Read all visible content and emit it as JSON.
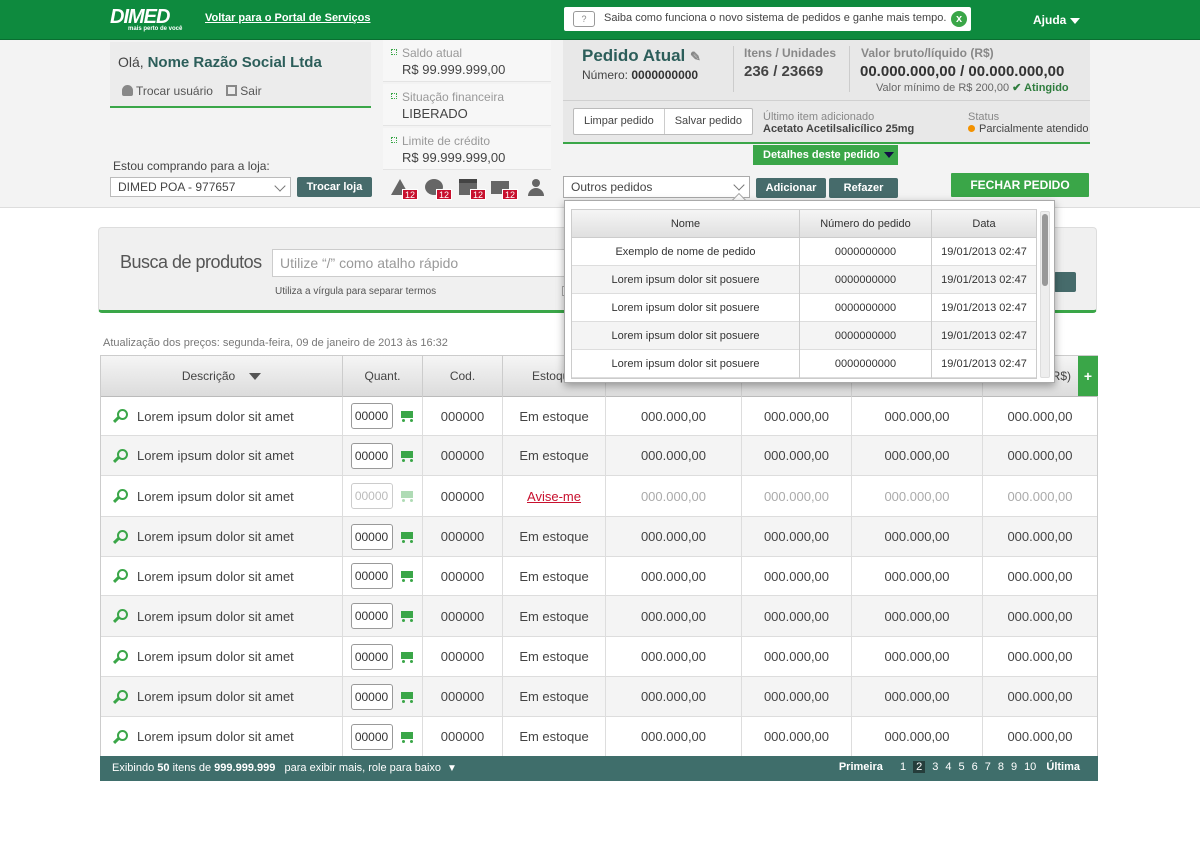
{
  "topbar": {
    "logo": "DIMED",
    "logo_tagline": "mais perto de você",
    "back_link": "Voltar para o Portal de Serviços",
    "notice": "Saiba como funciona o novo sistema de pedidos e ganhe mais tempo.",
    "notice_close": "x",
    "help": "Ajuda"
  },
  "user": {
    "greeting": "Olá,",
    "name": "Nome Razão Social Ltda",
    "switch_user": "Trocar usuário",
    "logout": "Sair"
  },
  "store": {
    "label": "Estou comprando para a loja:",
    "selected": "DIMED POA - 977657",
    "switch_button": "Trocar loja"
  },
  "finance": {
    "balance_label": "Saldo atual",
    "balance_value": "R$ 99.999.999,00",
    "status_label": "Situação financeira",
    "status_value": "LIBERADO",
    "credit_label": "Limite de crédito",
    "credit_value": "R$ 99.999.999,00"
  },
  "alerts": [
    {
      "icon": "warning-icon",
      "count": "12"
    },
    {
      "icon": "money-icon",
      "count": "12"
    },
    {
      "icon": "calendar-icon",
      "count": "12"
    },
    {
      "icon": "mail-icon",
      "count": "12"
    },
    {
      "icon": "user-icon",
      "count": ""
    }
  ],
  "order": {
    "title": "Pedido Atual",
    "number_label": "Número:",
    "number": "0000000000",
    "items_label": "Itens / Unidades",
    "items_value": "236 / 23669",
    "value_label": "Valor bruto/líquido (R$)",
    "value_value": "00.000.000,00 / 00.000.000,00",
    "min_label": "Valor mínimo de R$ 200,00",
    "min_status": "Atingido",
    "clear_button": "Limpar pedido",
    "save_button": "Salvar pedido",
    "last_item_label": "Último item adicionado",
    "last_item_value": "Acetato Acetilsalicílico 25mg",
    "status_label": "Status",
    "status_value": "Parcialmente atendido",
    "details_button": "Detalhes deste pedido",
    "other_orders_select": "Outros pedidos",
    "add_button": "Adicionar",
    "redo_button": "Refazer",
    "close_button": "FECHAR PEDIDO"
  },
  "dropdown": {
    "headers": [
      "Nome",
      "Número do pedido",
      "Data"
    ],
    "rows": [
      [
        "Exemplo de nome de pedido",
        "0000000000",
        "19/01/2013 02:47"
      ],
      [
        "Lorem ipsum dolor sit posuere",
        "0000000000",
        "19/01/2013 02:47"
      ],
      [
        "Lorem ipsum dolor sit posuere",
        "0000000000",
        "19/01/2013 02:47"
      ],
      [
        "Lorem ipsum dolor sit posuere",
        "0000000000",
        "19/01/2013 02:47"
      ],
      [
        "Lorem ipsum dolor sit posuere",
        "0000000000",
        "19/01/2013 02:47"
      ]
    ]
  },
  "search": {
    "title": "Busca de produtos",
    "placeholder": "Utilize “/” como atalho rápido",
    "hint": "Utiliza a vírgula para separar termos"
  },
  "price_update": "Atualização dos preços: segunda-feira, 09 de janeiro de 2013 às 16:32",
  "table": {
    "headers": [
      "Descrição",
      "Quant.",
      "Cod.",
      "Estoque",
      "",
      "",
      "",
      "R$)"
    ],
    "add_column": "+",
    "rows": [
      {
        "desc": "Lorem ipsum dolor sit amet",
        "qty": "00000",
        "code": "000000",
        "stock": "Em estoque",
        "p1": "000.000,00",
        "p2": "000.000,00",
        "p3": "000.000,00",
        "p4": "000.000,00"
      },
      {
        "desc": "Lorem ipsum dolor sit amet",
        "qty": "00000",
        "code": "000000",
        "stock": "Em estoque",
        "p1": "000.000,00",
        "p2": "000.000,00",
        "p3": "000.000,00",
        "p4": "000.000,00"
      },
      {
        "desc": "Lorem ipsum dolor sit amet",
        "qty": "00000",
        "code": "000000",
        "stock": "Avise-me",
        "p1": "000.000,00",
        "p2": "000.000,00",
        "p3": "000.000,00",
        "p4": "000.000,00"
      },
      {
        "desc": "Lorem ipsum dolor sit amet",
        "qty": "00000",
        "code": "000000",
        "stock": "Em estoque",
        "p1": "000.000,00",
        "p2": "000.000,00",
        "p3": "000.000,00",
        "p4": "000.000,00"
      },
      {
        "desc": "Lorem ipsum dolor sit amet",
        "qty": "00000",
        "code": "000000",
        "stock": "Em estoque",
        "p1": "000.000,00",
        "p2": "000.000,00",
        "p3": "000.000,00",
        "p4": "000.000,00"
      },
      {
        "desc": "Lorem ipsum dolor sit amet",
        "qty": "00000",
        "code": "000000",
        "stock": "Em estoque",
        "p1": "000.000,00",
        "p2": "000.000,00",
        "p3": "000.000,00",
        "p4": "000.000,00"
      },
      {
        "desc": "Lorem ipsum dolor sit amet",
        "qty": "00000",
        "code": "000000",
        "stock": "Em estoque",
        "p1": "000.000,00",
        "p2": "000.000,00",
        "p3": "000.000,00",
        "p4": "000.000,00"
      },
      {
        "desc": "Lorem ipsum dolor sit amet",
        "qty": "00000",
        "code": "000000",
        "stock": "Em estoque",
        "p1": "000.000,00",
        "p2": "000.000,00",
        "p3": "000.000,00",
        "p4": "000.000,00"
      },
      {
        "desc": "Lorem ipsum dolor sit amet",
        "qty": "00000",
        "code": "000000",
        "stock": "Em estoque",
        "p1": "000.000,00",
        "p2": "000.000,00",
        "p3": "000.000,00",
        "p4": "000.000,00"
      }
    ]
  },
  "footer": {
    "showing": "Exibindo",
    "shown_count": "50",
    "items_of": "itens de",
    "total": "999.999.999",
    "scroll_hint": "para exibir mais, role para baixo",
    "first": "Primeira",
    "last": "Última",
    "pages": [
      "1",
      "2",
      "3",
      "4",
      "5",
      "6",
      "7",
      "8",
      "9",
      "10"
    ],
    "current_page": "2"
  },
  "colors": {
    "brand_green": "#0e8a3e",
    "accent_green": "#3aa648",
    "dark_teal": "#466b6b",
    "alert_red": "#c8102e",
    "status_orange": "#f39200"
  }
}
